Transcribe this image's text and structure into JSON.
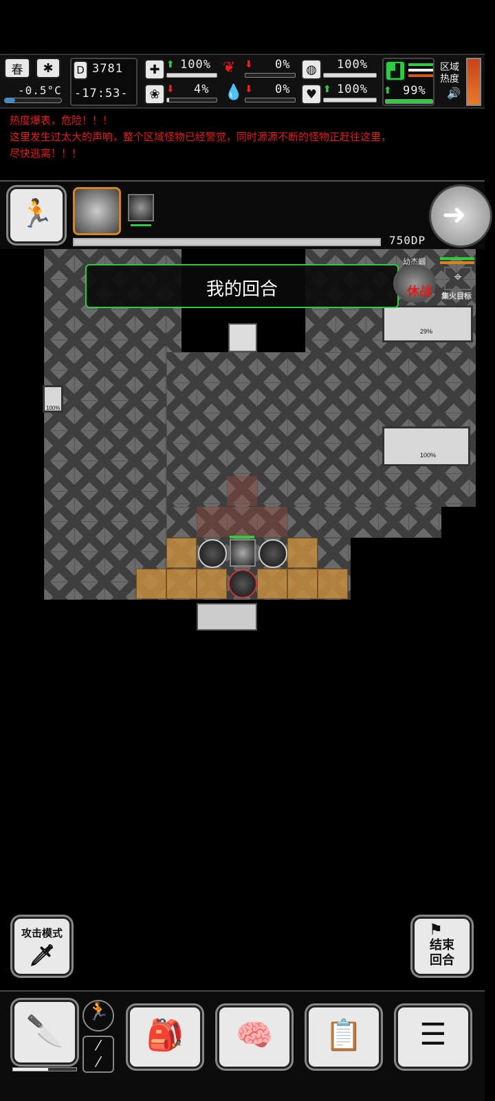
{
  "status": {
    "season": "春",
    "temperature": "-0.5°C",
    "day_counter": "3781",
    "time": "-17:53-",
    "stats": [
      {
        "name": "medical",
        "icon": "medkit-icon",
        "value": "100%",
        "trend": "up"
      },
      {
        "name": "stomach",
        "icon": "stomach-icon",
        "value": "0%",
        "trend": "down"
      },
      {
        "name": "water",
        "icon": "water-icon",
        "value": "100%",
        "trend": "none"
      },
      {
        "name": "digestion",
        "icon": "intestine-icon",
        "value": "4%",
        "trend": "down"
      },
      {
        "name": "blood",
        "icon": "blood-drop-icon",
        "value": "0%",
        "trend": "down"
      },
      {
        "name": "health",
        "icon": "heart-icon",
        "value": "100%",
        "trend": "up"
      },
      {
        "name": "stamina",
        "icon": "boot-icon",
        "value": "99%",
        "trend": "up"
      }
    ],
    "zone_heat_label": "区域\n热度",
    "zone_heat_level": 1.0
  },
  "messages": [
    "热度爆表，危险！！！",
    "这里发生过太大的声响，整个区域怪物已经警觉，同时源源不断的怪物正赶往这里，",
    "尽快逃离！！！"
  ],
  "turn": {
    "ap_text": "750DP",
    "banner": "我的回合",
    "next_icon": "arrow-right-icon"
  },
  "enemy_panel": {
    "name": "幼杰蝈",
    "state": "休战",
    "focus_fire_label": "集火目标"
  },
  "map": {
    "containers": [
      {
        "id": "locker-top",
        "pct": "29%"
      },
      {
        "id": "wall-safe",
        "pct": "100%"
      },
      {
        "id": "locker-mid",
        "pct": "100%"
      }
    ]
  },
  "controls": {
    "attack_mode": "攻击模式",
    "end_turn": "结束\n回合",
    "bottom_nav": [
      {
        "id": "weapon",
        "icon": "knife-icon"
      },
      {
        "id": "inventory",
        "icon": "backpack-icon"
      },
      {
        "id": "skills",
        "icon": "brain-icon"
      },
      {
        "id": "journal",
        "icon": "notebook-icon"
      },
      {
        "id": "menu",
        "icon": "menu-list-icon"
      }
    ]
  },
  "colors": {
    "danger_text": "#e31c1c",
    "move_tile": "#c48d3e",
    "heat_gauge": "#d8561a",
    "banner_border": "#2ecc40"
  }
}
